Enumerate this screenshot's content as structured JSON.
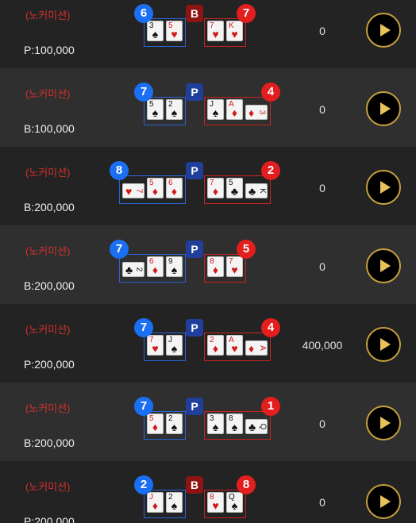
{
  "rows": [
    {
      "tag": "(노커미션)",
      "bet": "P:100,000",
      "payout": "0",
      "winner": "B",
      "player_score": "6",
      "banker_score": "7",
      "player_cards": [
        {
          "rank": "3",
          "suit": "♠",
          "color": "blk"
        },
        {
          "rank": "5",
          "suit": "♥",
          "color": "red"
        }
      ],
      "banker_cards": [
        {
          "rank": "7",
          "suit": "♥",
          "color": "red"
        },
        {
          "rank": "K",
          "suit": "♥",
          "color": "red"
        }
      ]
    },
    {
      "tag": "(노커미션)",
      "bet": "B:100,000",
      "payout": "0",
      "winner": "P",
      "player_score": "7",
      "banker_score": "4",
      "player_cards": [
        {
          "rank": "5",
          "suit": "♠",
          "color": "blk"
        },
        {
          "rank": "2",
          "suit": "♠",
          "color": "blk"
        }
      ],
      "banker_cards": [
        {
          "rank": "J",
          "suit": "♠",
          "color": "blk"
        },
        {
          "rank": "A",
          "suit": "♦",
          "color": "red"
        },
        {
          "rank": "3",
          "suit": "♦",
          "color": "red",
          "rotated": true
        }
      ]
    },
    {
      "tag": "(노커미션)",
      "bet": "B:200,000",
      "payout": "0",
      "winner": "P",
      "player_score": "8",
      "banker_score": "2",
      "player_cards": [
        {
          "rank": "7",
          "suit": "♥",
          "color": "red",
          "rotated": true
        },
        {
          "rank": "5",
          "suit": "♦",
          "color": "red"
        },
        {
          "rank": "6",
          "suit": "♦",
          "color": "red"
        }
      ],
      "banker_cards": [
        {
          "rank": "7",
          "suit": "♦",
          "color": "red"
        },
        {
          "rank": "5",
          "suit": "♣",
          "color": "blk"
        },
        {
          "rank": "K",
          "suit": "♣",
          "color": "blk",
          "rotated": true
        }
      ]
    },
    {
      "tag": "(노커미션)",
      "bet": "B:200,000",
      "payout": "0",
      "winner": "P",
      "player_score": "7",
      "banker_score": "5",
      "player_cards": [
        {
          "rank": "2",
          "suit": "♣",
          "color": "blk",
          "rotated": true
        },
        {
          "rank": "6",
          "suit": "♦",
          "color": "red"
        },
        {
          "rank": "9",
          "suit": "♠",
          "color": "blk"
        }
      ],
      "banker_cards": [
        {
          "rank": "8",
          "suit": "♦",
          "color": "red"
        },
        {
          "rank": "7",
          "suit": "♥",
          "color": "red"
        }
      ]
    },
    {
      "tag": "(노커미션)",
      "bet": "P:200,000",
      "payout": "400,000",
      "winner": "P",
      "player_score": "7",
      "banker_score": "4",
      "player_cards": [
        {
          "rank": "7",
          "suit": "♥",
          "color": "red"
        },
        {
          "rank": "J",
          "suit": "♠",
          "color": "blk"
        }
      ],
      "banker_cards": [
        {
          "rank": "2",
          "suit": "♦",
          "color": "red"
        },
        {
          "rank": "A",
          "suit": "♥",
          "color": "red"
        },
        {
          "rank": "A",
          "suit": "♦",
          "color": "red",
          "rotated": true
        }
      ]
    },
    {
      "tag": "(노커미션)",
      "bet": "B:200,000",
      "payout": "0",
      "winner": "P",
      "player_score": "7",
      "banker_score": "1",
      "player_cards": [
        {
          "rank": "5",
          "suit": "♦",
          "color": "red"
        },
        {
          "rank": "2",
          "suit": "♠",
          "color": "blk"
        }
      ],
      "banker_cards": [
        {
          "rank": "3",
          "suit": "♠",
          "color": "blk"
        },
        {
          "rank": "8",
          "suit": "♠",
          "color": "blk"
        },
        {
          "rank": "Q",
          "suit": "♣",
          "color": "blk",
          "rotated": true
        }
      ]
    },
    {
      "tag": "(노커미션)",
      "bet": "P:200,000",
      "payout": "0",
      "winner": "B",
      "player_score": "2",
      "banker_score": "8",
      "player_cards": [
        {
          "rank": "J",
          "suit": "♦",
          "color": "red"
        },
        {
          "rank": "2",
          "suit": "♠",
          "color": "blk"
        }
      ],
      "banker_cards": [
        {
          "rank": "8",
          "suit": "♥",
          "color": "red"
        },
        {
          "rank": "Q",
          "suit": "♠",
          "color": "blk"
        }
      ]
    }
  ],
  "icons": {
    "play": "play-icon"
  },
  "colors": {
    "player": "#1a6ff2",
    "banker": "#e21e1e",
    "gold": "#c8a13e"
  }
}
